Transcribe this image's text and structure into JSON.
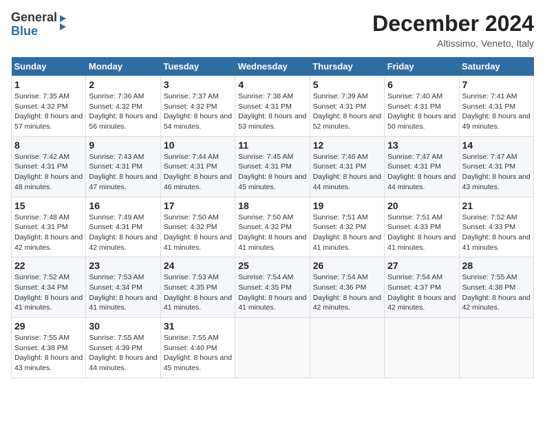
{
  "header": {
    "logo_general": "General",
    "logo_blue": "Blue",
    "month_title": "December 2024",
    "location": "Altissimo, Veneto, Italy"
  },
  "weekdays": [
    "Sunday",
    "Monday",
    "Tuesday",
    "Wednesday",
    "Thursday",
    "Friday",
    "Saturday"
  ],
  "weeks": [
    [
      {
        "day": "1",
        "sunrise": "Sunrise: 7:35 AM",
        "sunset": "Sunset: 4:32 PM",
        "daylight": "Daylight: 8 hours and 57 minutes."
      },
      {
        "day": "2",
        "sunrise": "Sunrise: 7:36 AM",
        "sunset": "Sunset: 4:32 PM",
        "daylight": "Daylight: 8 hours and 56 minutes."
      },
      {
        "day": "3",
        "sunrise": "Sunrise: 7:37 AM",
        "sunset": "Sunset: 4:32 PM",
        "daylight": "Daylight: 8 hours and 54 minutes."
      },
      {
        "day": "4",
        "sunrise": "Sunrise: 7:38 AM",
        "sunset": "Sunset: 4:31 PM",
        "daylight": "Daylight: 8 hours and 53 minutes."
      },
      {
        "day": "5",
        "sunrise": "Sunrise: 7:39 AM",
        "sunset": "Sunset: 4:31 PM",
        "daylight": "Daylight: 8 hours and 52 minutes."
      },
      {
        "day": "6",
        "sunrise": "Sunrise: 7:40 AM",
        "sunset": "Sunset: 4:31 PM",
        "daylight": "Daylight: 8 hours and 50 minutes."
      },
      {
        "day": "7",
        "sunrise": "Sunrise: 7:41 AM",
        "sunset": "Sunset: 4:31 PM",
        "daylight": "Daylight: 8 hours and 49 minutes."
      }
    ],
    [
      {
        "day": "8",
        "sunrise": "Sunrise: 7:42 AM",
        "sunset": "Sunset: 4:31 PM",
        "daylight": "Daylight: 8 hours and 48 minutes."
      },
      {
        "day": "9",
        "sunrise": "Sunrise: 7:43 AM",
        "sunset": "Sunset: 4:31 PM",
        "daylight": "Daylight: 8 hours and 47 minutes."
      },
      {
        "day": "10",
        "sunrise": "Sunrise: 7:44 AM",
        "sunset": "Sunset: 4:31 PM",
        "daylight": "Daylight: 8 hours and 46 minutes."
      },
      {
        "day": "11",
        "sunrise": "Sunrise: 7:45 AM",
        "sunset": "Sunset: 4:31 PM",
        "daylight": "Daylight: 8 hours and 45 minutes."
      },
      {
        "day": "12",
        "sunrise": "Sunrise: 7:46 AM",
        "sunset": "Sunset: 4:31 PM",
        "daylight": "Daylight: 8 hours and 44 minutes."
      },
      {
        "day": "13",
        "sunrise": "Sunrise: 7:47 AM",
        "sunset": "Sunset: 4:31 PM",
        "daylight": "Daylight: 8 hours and 44 minutes."
      },
      {
        "day": "14",
        "sunrise": "Sunrise: 7:47 AM",
        "sunset": "Sunset: 4:31 PM",
        "daylight": "Daylight: 8 hours and 43 minutes."
      }
    ],
    [
      {
        "day": "15",
        "sunrise": "Sunrise: 7:48 AM",
        "sunset": "Sunset: 4:31 PM",
        "daylight": "Daylight: 8 hours and 42 minutes."
      },
      {
        "day": "16",
        "sunrise": "Sunrise: 7:49 AM",
        "sunset": "Sunset: 4:31 PM",
        "daylight": "Daylight: 8 hours and 42 minutes."
      },
      {
        "day": "17",
        "sunrise": "Sunrise: 7:50 AM",
        "sunset": "Sunset: 4:32 PM",
        "daylight": "Daylight: 8 hours and 41 minutes."
      },
      {
        "day": "18",
        "sunrise": "Sunrise: 7:50 AM",
        "sunset": "Sunset: 4:32 PM",
        "daylight": "Daylight: 8 hours and 41 minutes."
      },
      {
        "day": "19",
        "sunrise": "Sunrise: 7:51 AM",
        "sunset": "Sunset: 4:32 PM",
        "daylight": "Daylight: 8 hours and 41 minutes."
      },
      {
        "day": "20",
        "sunrise": "Sunrise: 7:51 AM",
        "sunset": "Sunset: 4:33 PM",
        "daylight": "Daylight: 8 hours and 41 minutes."
      },
      {
        "day": "21",
        "sunrise": "Sunrise: 7:52 AM",
        "sunset": "Sunset: 4:33 PM",
        "daylight": "Daylight: 8 hours and 41 minutes."
      }
    ],
    [
      {
        "day": "22",
        "sunrise": "Sunrise: 7:52 AM",
        "sunset": "Sunset: 4:34 PM",
        "daylight": "Daylight: 8 hours and 41 minutes."
      },
      {
        "day": "23",
        "sunrise": "Sunrise: 7:53 AM",
        "sunset": "Sunset: 4:34 PM",
        "daylight": "Daylight: 8 hours and 41 minutes."
      },
      {
        "day": "24",
        "sunrise": "Sunrise: 7:53 AM",
        "sunset": "Sunset: 4:35 PM",
        "daylight": "Daylight: 8 hours and 41 minutes."
      },
      {
        "day": "25",
        "sunrise": "Sunrise: 7:54 AM",
        "sunset": "Sunset: 4:35 PM",
        "daylight": "Daylight: 8 hours and 41 minutes."
      },
      {
        "day": "26",
        "sunrise": "Sunrise: 7:54 AM",
        "sunset": "Sunset: 4:36 PM",
        "daylight": "Daylight: 8 hours and 42 minutes."
      },
      {
        "day": "27",
        "sunrise": "Sunrise: 7:54 AM",
        "sunset": "Sunset: 4:37 PM",
        "daylight": "Daylight: 8 hours and 42 minutes."
      },
      {
        "day": "28",
        "sunrise": "Sunrise: 7:55 AM",
        "sunset": "Sunset: 4:38 PM",
        "daylight": "Daylight: 8 hours and 42 minutes."
      }
    ],
    [
      {
        "day": "29",
        "sunrise": "Sunrise: 7:55 AM",
        "sunset": "Sunset: 4:38 PM",
        "daylight": "Daylight: 8 hours and 43 minutes."
      },
      {
        "day": "30",
        "sunrise": "Sunrise: 7:55 AM",
        "sunset": "Sunset: 4:39 PM",
        "daylight": "Daylight: 8 hours and 44 minutes."
      },
      {
        "day": "31",
        "sunrise": "Sunrise: 7:55 AM",
        "sunset": "Sunset: 4:40 PM",
        "daylight": "Daylight: 8 hours and 45 minutes."
      },
      null,
      null,
      null,
      null
    ]
  ]
}
